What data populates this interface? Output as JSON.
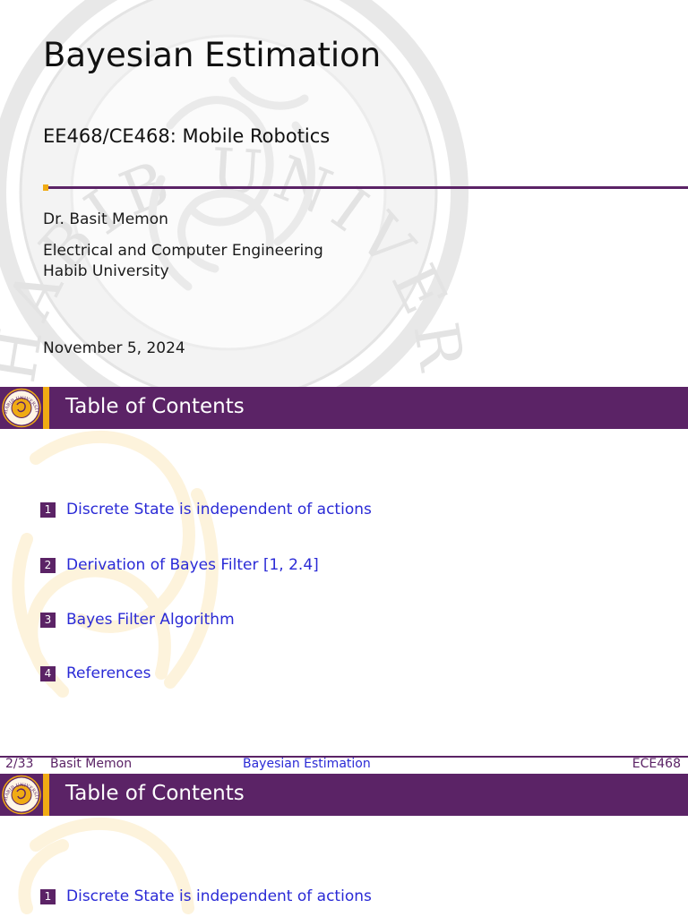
{
  "title_slide": {
    "title": "Bayesian Estimation",
    "subtitle": "EE468/CE468: Mobile Robotics",
    "author": "Dr. Basit Memon",
    "institute_line1": "Electrical and Computer Engineering",
    "institute_line2": "Habib University",
    "date": "November 5, 2024",
    "watermark_text": "HABIB UNIVERSITY"
  },
  "toc_slide": {
    "frame_title": "Table of Contents",
    "items": [
      {
        "number": "1",
        "label": "Discrete State is independent of actions"
      },
      {
        "number": "2",
        "label": "Derivation of Bayes Filter [1, 2.4]"
      },
      {
        "number": "3",
        "label": "Bayes Filter Algorithm"
      },
      {
        "number": "4",
        "label": "References"
      }
    ]
  },
  "footer": {
    "page": "2/33",
    "author": "Basit Memon",
    "title": "Bayesian Estimation",
    "course": "ECE468"
  },
  "logo": {
    "seal_text": "HABIB UNIVERSITY",
    "icon": "university-seal-icon"
  },
  "colors": {
    "primary": "#5b2366",
    "accent": "#f0ab14",
    "link": "#2a2ad6"
  }
}
